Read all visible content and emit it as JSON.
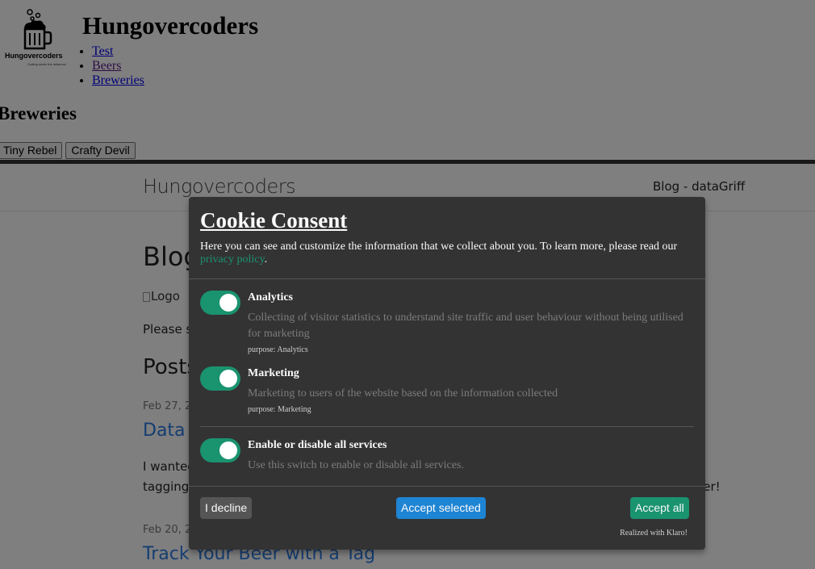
{
  "top_site": {
    "title": "Hungovercoders",
    "logo": {
      "caption": "Hungovercoders",
      "tagline": "Coding under the influence"
    },
    "nav": [
      {
        "label": "Test"
      },
      {
        "label": "Beers"
      },
      {
        "label": "Breweries"
      }
    ],
    "section_heading": "Breweries",
    "brewery_buttons": [
      "Tiny Rebel",
      "Crafty Devil"
    ]
  },
  "blog": {
    "brand": "Hungovercoders",
    "nav_link": "Blog - dataGriff",
    "heading": "Blog",
    "logo_alt": "Logo",
    "intro_partial": "Please s",
    "posts_heading": "Posts",
    "posts": [
      {
        "date": "Feb 27, 2",
        "title": "Data",
        "excerpt_line1": "I wanted",
        "excerpt_line2": "tagging",
        "excerpt_line2_right": "layer!"
      },
      {
        "date": "Feb 20, 2",
        "title": "Track Your Beer with a Tag"
      }
    ]
  },
  "cookie_modal": {
    "title": "Cookie Consent",
    "description": "Here you can see and customize the information that we collect about you. To learn more, please read our",
    "privacy_link": "privacy policy",
    "description_end": ".",
    "services": [
      {
        "name": "Analytics",
        "description": "Collecting of visitor statistics to understand site traffic and user behaviour without being utilised for marketing",
        "purpose": "purpose: Analytics",
        "enabled": true
      },
      {
        "name": "Marketing",
        "description": "Marketing to users of the website based on the information collected",
        "purpose": "purpose: Marketing",
        "enabled": true
      }
    ],
    "toggle_all": {
      "name": "Enable or disable all services",
      "description": "Use this switch to enable or disable all services.",
      "enabled": true
    },
    "buttons": {
      "decline": "I decline",
      "accept_selected": "Accept selected",
      "accept_all": "Accept all"
    },
    "footer": "Realized with Klaro!"
  },
  "colors": {
    "modal_bg": "#333333",
    "toggle_on": "#1a936f",
    "accept_selected": "#1e84d4",
    "decline": "#555555",
    "link_green": "#1a936f"
  }
}
